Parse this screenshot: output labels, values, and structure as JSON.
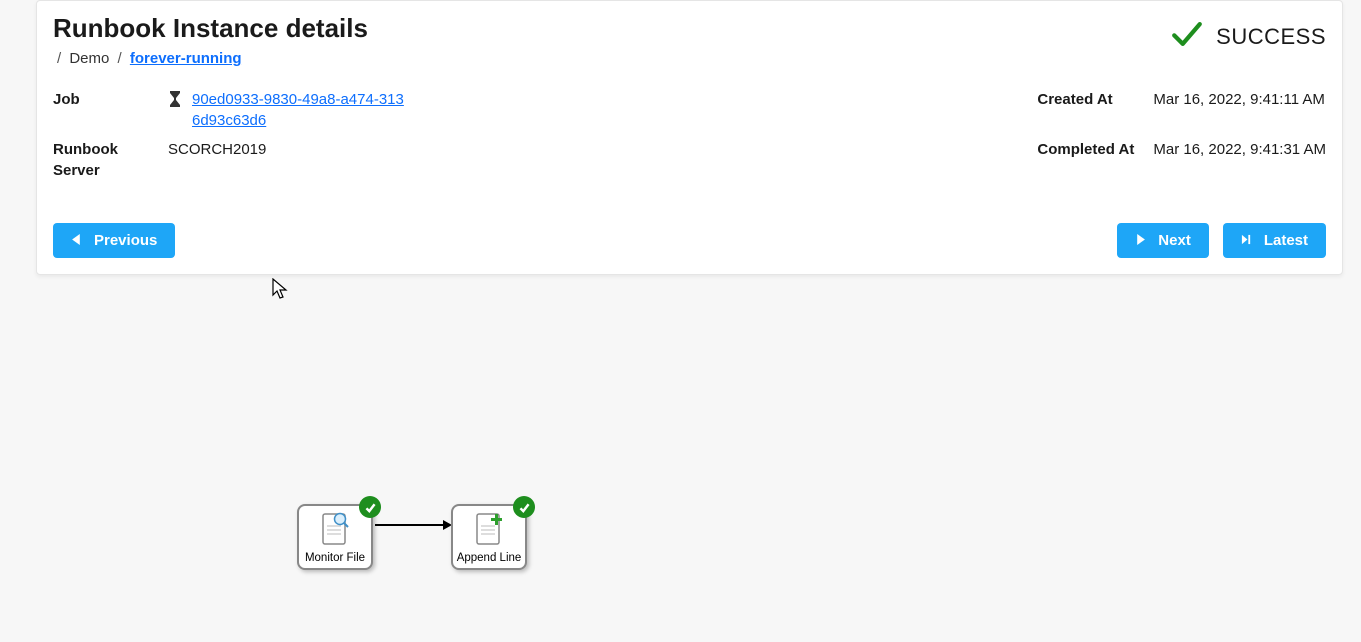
{
  "page_title": "Runbook Instance details",
  "breadcrumb": {
    "item1": "Demo",
    "item2": "forever-running"
  },
  "status": {
    "text": "SUCCESS"
  },
  "details": {
    "job_label": "Job",
    "job_id": "90ed0933-9830-49a8-a474-3136d93c63d6",
    "runbook_server_label": "Runbook Server",
    "runbook_server_value": "SCORCH2019",
    "created_at_label": "Created At",
    "created_at_value": "Mar 16, 2022, 9:41:11 AM",
    "completed_at_label": "Completed At",
    "completed_at_value": "Mar 16, 2022, 9:41:31 AM"
  },
  "buttons": {
    "previous": "Previous",
    "next": "Next",
    "latest": "Latest"
  },
  "diagram": {
    "node1_label": "Monitor File",
    "node2_label": "Append Line"
  },
  "colors": {
    "link_blue": "#0d6efd",
    "button_blue": "#1ea6f7",
    "success_green": "#1e8e1e"
  }
}
